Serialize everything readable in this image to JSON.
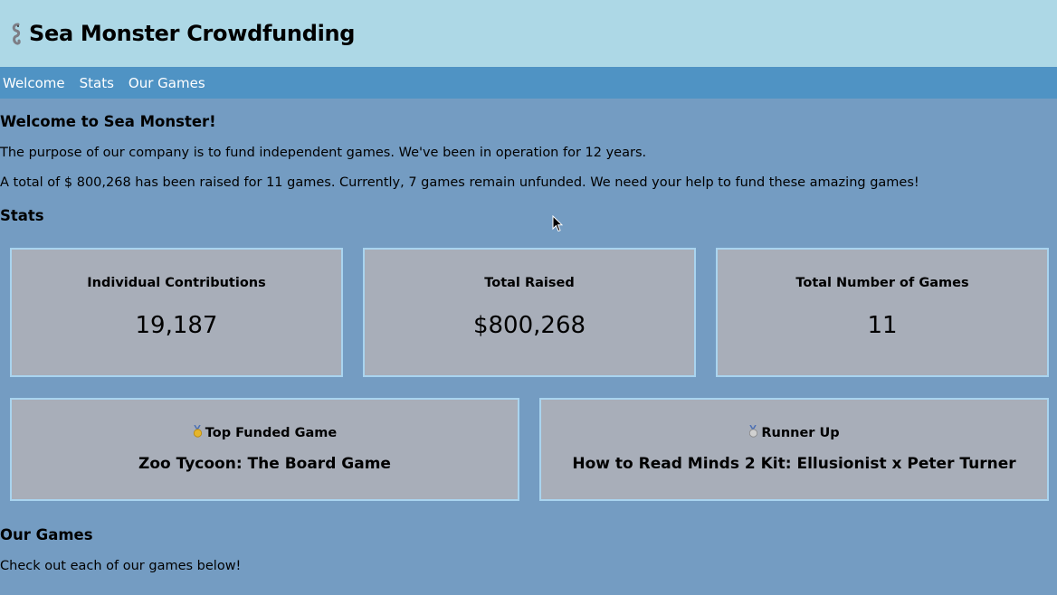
{
  "header": {
    "title": "Sea Monster Crowdfunding",
    "logo_icon": "seahorse-icon"
  },
  "nav": {
    "items": [
      {
        "label": "Welcome"
      },
      {
        "label": "Stats"
      },
      {
        "label": "Our Games"
      }
    ]
  },
  "welcome": {
    "title": "Welcome to Sea Monster!",
    "paragraph1": "The purpose of our company is to fund independent games. We've been in operation for 12 years.",
    "paragraph2": "A total of $ 800,268 has been raised for 11 games. Currently, 7 games remain unfunded. We need your help to fund these amazing games!"
  },
  "stats": {
    "title": "Stats",
    "cards": [
      {
        "label": "Individual Contributions",
        "value": "19,187"
      },
      {
        "label": "Total Raised",
        "value": "$800,268"
      },
      {
        "label": "Total Number of Games",
        "value": "11"
      }
    ],
    "top_funded": {
      "icon": "gold-medal-icon",
      "label": "Top Funded Game",
      "name": "Zoo Tycoon: The Board Game"
    },
    "runner_up": {
      "icon": "silver-medal-icon",
      "label": "Runner Up",
      "name": "How to Read Minds 2 Kit: Ellusionist x Peter Turner"
    }
  },
  "games": {
    "title": "Our Games",
    "subtitle": "Check out each of our games below!"
  },
  "colors": {
    "header_bg": "#add8e6",
    "nav_bg": "#4f93c4",
    "page_bg": "#749cc2",
    "card_bg": "#a8aeb9",
    "card_border": "#a9d4ef"
  }
}
